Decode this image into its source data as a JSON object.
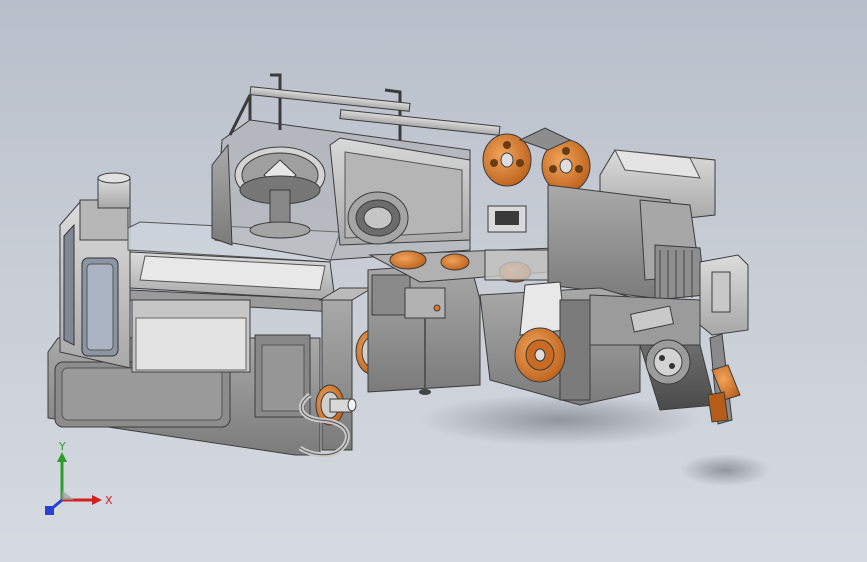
{
  "viewport": {
    "background_top": "#b9bfca",
    "background_bottom": "#d6dae1"
  },
  "model": {
    "metal_color": "#8f8f8f",
    "light_metal_color": "#c9c9c9",
    "dark_metal_color": "#5a5a5a",
    "accent_color": "#d9782a",
    "glass_color": "#cfd6df"
  },
  "triad": {
    "x_label": "X",
    "y_label": "Y",
    "x_color": "#d31f1f",
    "y_color": "#2aa02a",
    "z_color": "#2a3fd3"
  }
}
